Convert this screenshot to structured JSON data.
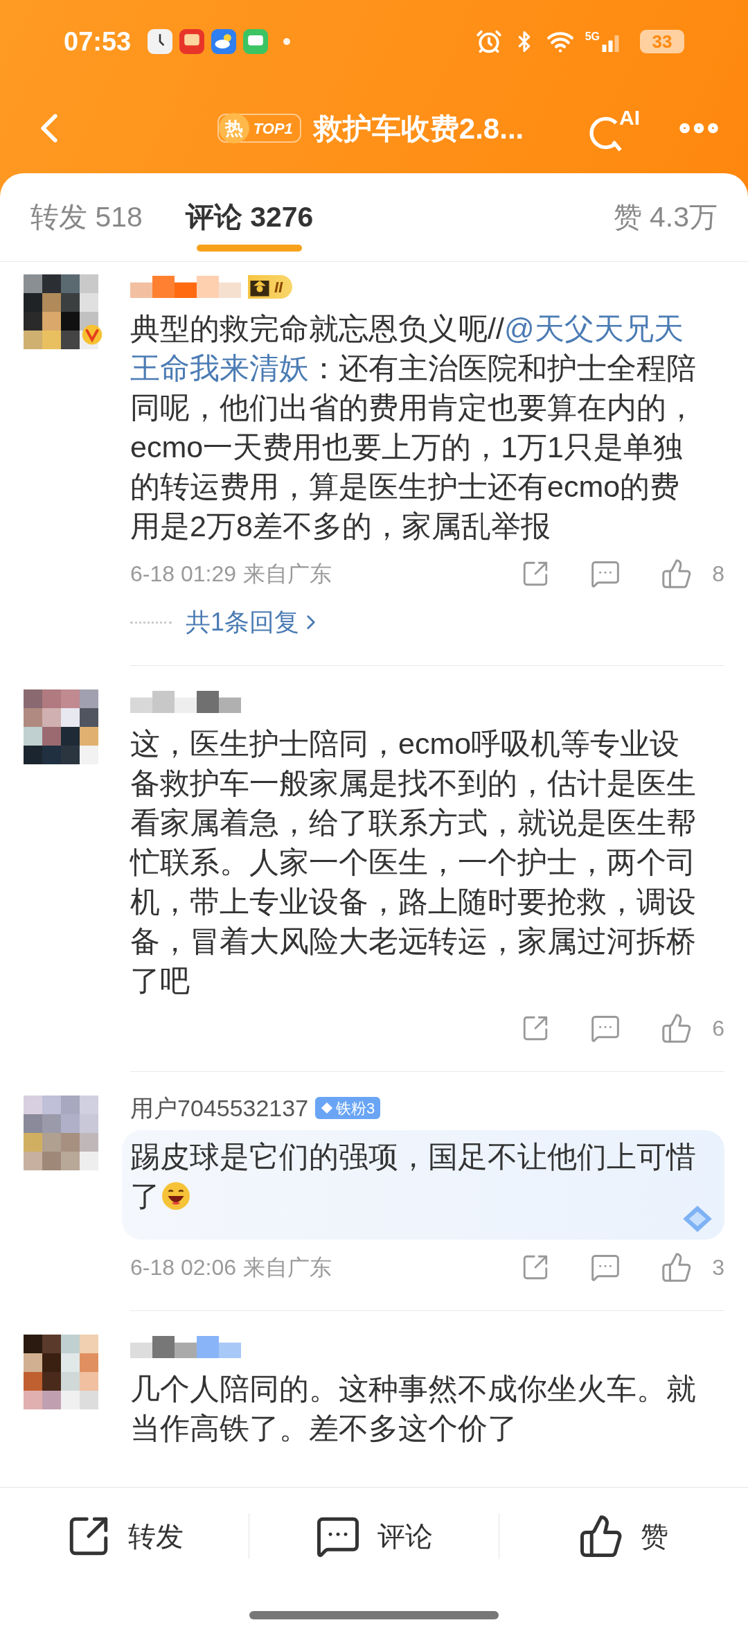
{
  "status_bar": {
    "time": "07:53",
    "network": "5G",
    "battery": "33"
  },
  "header": {
    "hot_label": "热",
    "rank": "TOP1",
    "title": "救护车收费2.8...",
    "ai_label": "AI"
  },
  "tabs": [
    {
      "label": "转发 518",
      "selected": false
    },
    {
      "label": "评论 3276",
      "selected": true
    },
    {
      "label": "赞 4.3万",
      "selected": false
    }
  ],
  "comments": [
    {
      "verified": true,
      "highlighted": false,
      "badge": {
        "kind": "level",
        "text": "II"
      },
      "parts": [
        {
          "kind": "text",
          "text": "典型的救完命就忘恩负义呃//"
        },
        {
          "kind": "mention",
          "text": "@天父天兄天"
        },
        {
          "kind": "mention",
          "text": "王命我来清妖"
        },
        {
          "kind": "text",
          "text": "：还有主治医院和护士全程陪同呢，他们出省的费用肯定也要算在内的，ecmo一天费用也要上万的，1万1只是单独的转运费用，算是医生护士还有ecmo的费用是2万8差不多的，家属乱举报"
        }
      ],
      "time": "6-18 01:29",
      "location": "来自广东",
      "likes": "8",
      "replies": "共1条回复"
    },
    {
      "verified": false,
      "highlighted": false,
      "parts": [
        {
          "kind": "text",
          "text": "这，医生护士陪同，ecmo呼吸机等专业设备救护车一般家属是找不到的，估计是医生看家属着急，给了联系方式，就说是医生帮忙联系。人家一个医生，一个护士，两个司机，带上专业设备，路上随时要抢救，调设备，冒着大风险大老远转运，家属过河拆桥了吧"
        }
      ],
      "likes": "6"
    },
    {
      "verified": false,
      "highlighted": true,
      "username": "用户7045532137",
      "badge": {
        "kind": "fan",
        "text": "铁粉3"
      },
      "parts": [
        {
          "kind": "text",
          "text": "踢皮球是它们的强项，国足不让他们上可惜了"
        }
      ],
      "emoji": {
        "kind": "laugh"
      },
      "time": "6-18 02:06",
      "location": "来自广东",
      "likes": "3"
    },
    {
      "verified": false,
      "highlighted": false,
      "parts": [
        {
          "kind": "text",
          "text": "几个人陪同的。这种事然不成你坐火车。就当作高铁了。差不多这个价了"
        }
      ]
    }
  ],
  "action_bar": [
    {
      "kind": "share",
      "label": "转发"
    },
    {
      "kind": "comment",
      "label": "评论"
    },
    {
      "kind": "like",
      "label": "赞"
    }
  ]
}
